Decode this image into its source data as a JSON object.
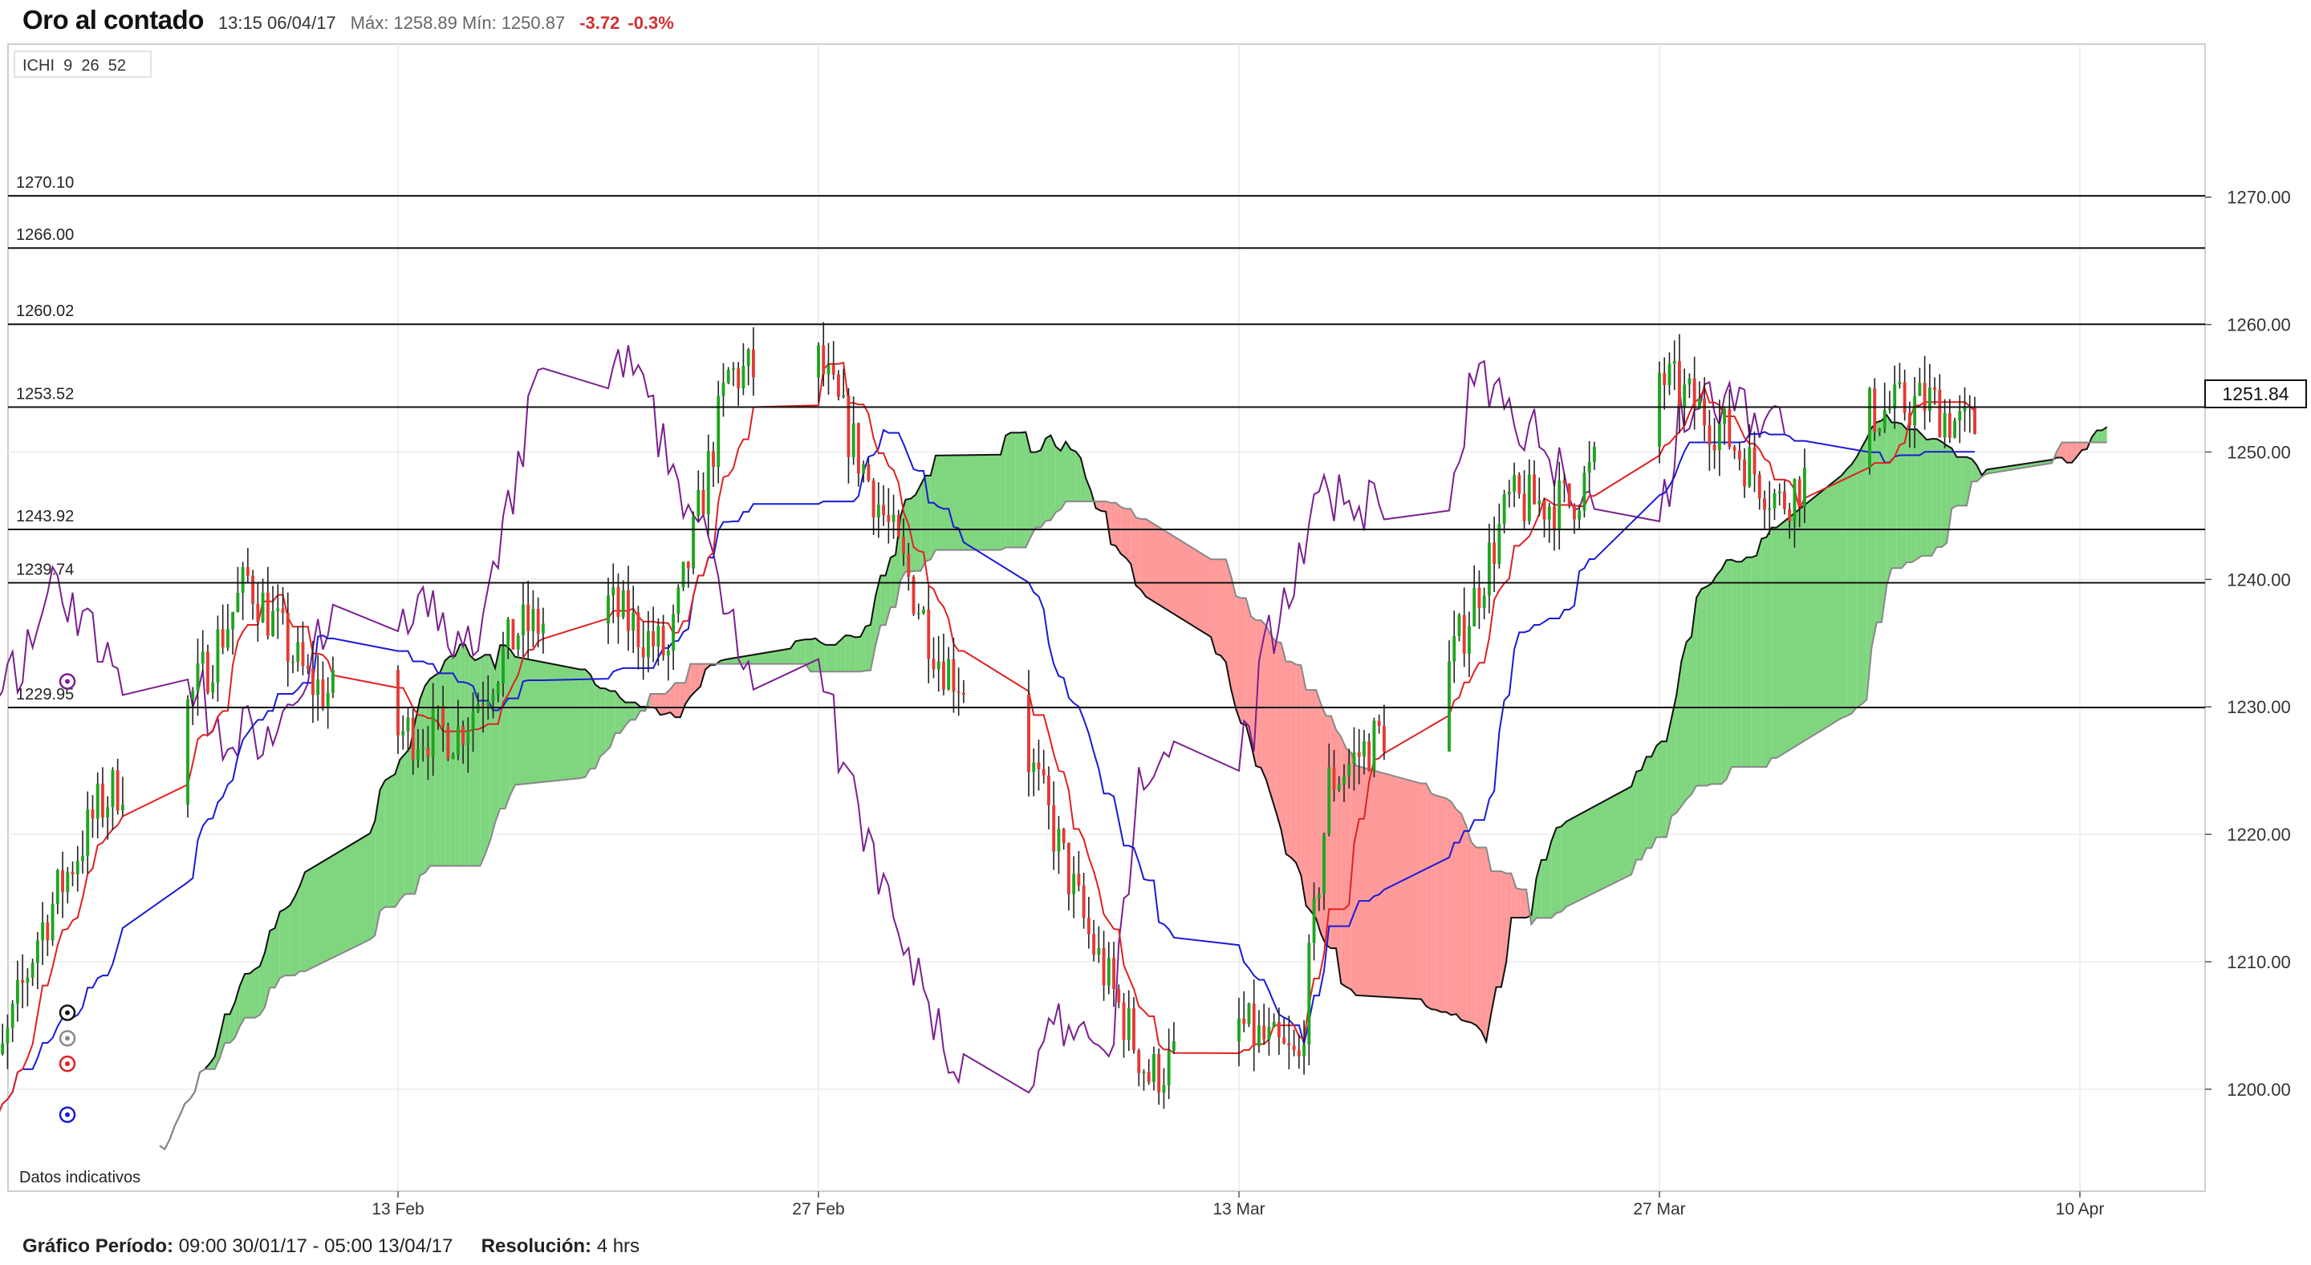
{
  "header": {
    "title": "Oro al contado",
    "datetime": "13:15 06/04/17",
    "max_label": "Máx:",
    "max_value": "1258.89",
    "min_label": "Mín:",
    "min_value": "1250.87",
    "change": "-3.72",
    "change_pct": "-0.3%"
  },
  "indicator_label": "ICHI  9  26  52",
  "footer": {
    "period_label": "Gráfico Período:",
    "period_value": "09:00 30/01/17 - 05:00 13/04/17",
    "resolution_label": "Resolución:",
    "resolution_value": "4 hrs"
  },
  "colors": {
    "up_candle": "#1fa51f",
    "down_candle": "#e53935",
    "tenkan": "#e02020",
    "kijun": "#1a1ad6",
    "chikou": "#7b1f8f",
    "kumo_bull": "#7fd67f",
    "kumo_bear": "#ff9a9a",
    "level_line": "#111111"
  },
  "chart_data": {
    "type": "candlestick",
    "title": "Oro al contado",
    "note": "Datos indicativos",
    "ylim": [
      1192,
      1282
    ],
    "y_ticks": [
      "1200.00",
      "1210.00",
      "1220.00",
      "1230.00",
      "1240.00",
      "1250.00",
      "1260.00",
      "1270.00"
    ],
    "x_ticks": [
      "13 Feb",
      "27 Feb",
      "13 Mar",
      "27 Mar",
      "10 Apr"
    ],
    "current_price": "1251.84",
    "levels": [
      "1270.10",
      "1266.00",
      "1260.02",
      "1253.52",
      "1243.92",
      "1239.74",
      "1229.95"
    ],
    "close_path": [
      {
        "date": "30 Jan",
        "close": 1196
      },
      {
        "date": "01 Feb",
        "close": 1212
      },
      {
        "date": "03 Feb",
        "close": 1222
      },
      {
        "date": "06 Feb",
        "close": 1230
      },
      {
        "date": "08 Feb",
        "close": 1240
      },
      {
        "date": "10 Feb",
        "close": 1232
      },
      {
        "date": "13 Feb",
        "close": 1228
      },
      {
        "date": "15 Feb",
        "close": 1228
      },
      {
        "date": "17 Feb",
        "close": 1236
      },
      {
        "date": "20 Feb",
        "close": 1238
      },
      {
        "date": "22 Feb",
        "close": 1234
      },
      {
        "date": "24 Feb",
        "close": 1256
      },
      {
        "date": "27 Feb",
        "close": 1257
      },
      {
        "date": "01 Mar",
        "close": 1246
      },
      {
        "date": "03 Mar",
        "close": 1234
      },
      {
        "date": "06 Mar",
        "close": 1226
      },
      {
        "date": "08 Mar",
        "close": 1212
      },
      {
        "date": "10 Mar",
        "close": 1201
      },
      {
        "date": "13 Mar",
        "close": 1205
      },
      {
        "date": "15 Mar",
        "close": 1202
      },
      {
        "date": "16 Mar",
        "close": 1224
      },
      {
        "date": "20 Mar",
        "close": 1233
      },
      {
        "date": "22 Mar",
        "close": 1246
      },
      {
        "date": "24 Mar",
        "close": 1246
      },
      {
        "date": "27 Mar",
        "close": 1256
      },
      {
        "date": "29 Mar",
        "close": 1252
      },
      {
        "date": "31 Mar",
        "close": 1246
      },
      {
        "date": "03 Apr",
        "close": 1253
      },
      {
        "date": "05 Apr",
        "close": 1254
      },
      {
        "date": "06 Apr",
        "close": 1252
      }
    ]
  }
}
